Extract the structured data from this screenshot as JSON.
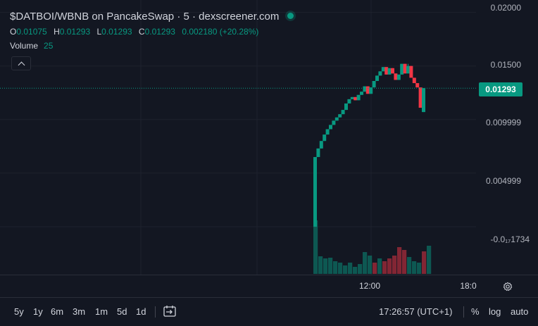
{
  "legend": {
    "title": "$DATBOI/WBNB on PancakeSwap · 5 · dexscreener.com",
    "open_key": "O",
    "open": "0.01075",
    "high_key": "H",
    "high": "0.01293",
    "low_key": "L",
    "low": "0.01293",
    "close_key": "C",
    "close": "0.01293",
    "change": "0.002180 (+20.28%)"
  },
  "volume": {
    "label": "Volume",
    "value": "25"
  },
  "price_scale": {
    "ticks": [
      "0.02000",
      "0.01500",
      "0.009999",
      "0.004999",
      "-0.0₁₇1734"
    ],
    "current_price": "0.01293"
  },
  "time_axis": {
    "ticks": [
      "12:00",
      "18:0"
    ]
  },
  "bottom_bar": {
    "timeframes": [
      "5y",
      "1y",
      "6m",
      "3m",
      "1m",
      "5d",
      "1d"
    ],
    "clock": "17:26:57 (UTC+1)",
    "percent": "%",
    "log": "log",
    "auto": "auto"
  },
  "colors": {
    "background": "#131722",
    "up": "#089981",
    "down": "#f23645",
    "grid": "#1e222d",
    "text": "#d1d4dc"
  },
  "chart_data": {
    "type": "candlestick",
    "y_range": [
      -0.0025,
      0.0205
    ],
    "current_price": 0.01293,
    "candles": [
      {
        "o": 0.0,
        "c": 0.0065,
        "h": 0.0065,
        "l": 0.0
      },
      {
        "o": 0.0065,
        "c": 0.0073,
        "h": 0.0073,
        "l": 0.0065
      },
      {
        "o": 0.0073,
        "c": 0.008,
        "h": 0.008,
        "l": 0.0073
      },
      {
        "o": 0.008,
        "c": 0.0086,
        "h": 0.0086,
        "l": 0.008
      },
      {
        "o": 0.0086,
        "c": 0.0091,
        "h": 0.0091,
        "l": 0.0086
      },
      {
        "o": 0.0091,
        "c": 0.0095,
        "h": 0.0095,
        "l": 0.0091
      },
      {
        "o": 0.0095,
        "c": 0.0099,
        "h": 0.0099,
        "l": 0.0095
      },
      {
        "o": 0.0099,
        "c": 0.0102,
        "h": 0.0102,
        "l": 0.0099
      },
      {
        "o": 0.0102,
        "c": 0.0105,
        "h": 0.0105,
        "l": 0.0102
      },
      {
        "o": 0.0105,
        "c": 0.0109,
        "h": 0.0109,
        "l": 0.0105
      },
      {
        "o": 0.0109,
        "c": 0.0115,
        "h": 0.0115,
        "l": 0.0109
      },
      {
        "o": 0.0115,
        "c": 0.0119,
        "h": 0.0119,
        "l": 0.0115
      },
      {
        "o": 0.0119,
        "c": 0.0121,
        "h": 0.0121,
        "l": 0.0119
      },
      {
        "o": 0.0121,
        "c": 0.0118,
        "h": 0.0121,
        "l": 0.0118
      },
      {
        "o": 0.0118,
        "c": 0.0123,
        "h": 0.0123,
        "l": 0.0118
      },
      {
        "o": 0.0123,
        "c": 0.0126,
        "h": 0.0126,
        "l": 0.0123
      },
      {
        "o": 0.0126,
        "c": 0.0131,
        "h": 0.0131,
        "l": 0.0126
      },
      {
        "o": 0.0131,
        "c": 0.0124,
        "h": 0.0131,
        "l": 0.0124
      },
      {
        "o": 0.0124,
        "c": 0.013,
        "h": 0.013,
        "l": 0.0124
      },
      {
        "o": 0.013,
        "c": 0.0136,
        "h": 0.0136,
        "l": 0.013
      },
      {
        "o": 0.0136,
        "c": 0.0141,
        "h": 0.0141,
        "l": 0.0136
      },
      {
        "o": 0.0141,
        "c": 0.0145,
        "h": 0.0145,
        "l": 0.0141
      },
      {
        "o": 0.0145,
        "c": 0.0149,
        "h": 0.0149,
        "l": 0.0145
      },
      {
        "o": 0.0149,
        "c": 0.0142,
        "h": 0.0149,
        "l": 0.0142
      },
      {
        "o": 0.0142,
        "c": 0.0148,
        "h": 0.0148,
        "l": 0.0142
      },
      {
        "o": 0.0148,
        "c": 0.0143,
        "h": 0.0148,
        "l": 0.0143
      },
      {
        "o": 0.0143,
        "c": 0.0137,
        "h": 0.0143,
        "l": 0.0137
      },
      {
        "o": 0.0137,
        "c": 0.0142,
        "h": 0.0142,
        "l": 0.0137
      },
      {
        "o": 0.0142,
        "c": 0.0152,
        "h": 0.0152,
        "l": 0.0142
      },
      {
        "o": 0.0152,
        "c": 0.0143,
        "h": 0.0152,
        "l": 0.0143
      },
      {
        "o": 0.0143,
        "c": 0.015,
        "h": 0.0152,
        "l": 0.0143
      },
      {
        "o": 0.015,
        "c": 0.0139,
        "h": 0.015,
        "l": 0.0139
      },
      {
        "o": 0.0139,
        "c": 0.0134,
        "h": 0.0139,
        "l": 0.0134
      },
      {
        "o": 0.0134,
        "c": 0.013,
        "h": 0.0134,
        "l": 0.013
      },
      {
        "o": 0.013,
        "c": 0.0111,
        "h": 0.013,
        "l": 0.0111
      },
      {
        "o": 0.0107,
        "c": 0.01293,
        "h": 0.01293,
        "l": 0.0107
      }
    ],
    "volume": [
      {
        "v": 76,
        "up": true
      },
      {
        "v": 25,
        "up": true
      },
      {
        "v": 22,
        "up": true
      },
      {
        "v": 23,
        "up": true
      },
      {
        "v": 18,
        "up": true
      },
      {
        "v": 16,
        "up": true
      },
      {
        "v": 12,
        "up": true
      },
      {
        "v": 16,
        "up": true
      },
      {
        "v": 10,
        "up": true
      },
      {
        "v": 14,
        "up": true
      },
      {
        "v": 31,
        "up": true
      },
      {
        "v": 26,
        "up": true
      },
      {
        "v": 16,
        "up": false
      },
      {
        "v": 22,
        "up": true
      },
      {
        "v": 18,
        "up": false
      },
      {
        "v": 22,
        "up": false
      },
      {
        "v": 26,
        "up": false
      },
      {
        "v": 38,
        "up": false
      },
      {
        "v": 34,
        "up": false
      },
      {
        "v": 24,
        "up": true
      },
      {
        "v": 18,
        "up": true
      },
      {
        "v": 16,
        "up": true
      },
      {
        "v": 32,
        "up": false
      },
      {
        "v": 40,
        "up": true
      }
    ]
  }
}
